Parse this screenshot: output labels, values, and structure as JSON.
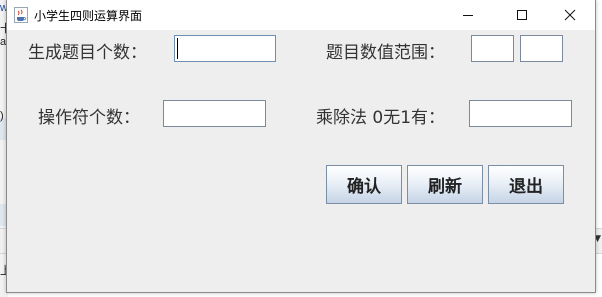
{
  "background": {
    "marks": [
      "w",
      "十",
      "a",
      ")",
      "上"
    ]
  },
  "window": {
    "title": "小学生四则运算界面",
    "icons": {
      "app": "java-coffee-icon",
      "minimize": "minimize-icon",
      "maximize": "maximize-icon",
      "close": "close-icon"
    }
  },
  "form": {
    "question_count_label": "生成题目个数：",
    "question_count_value": "",
    "range_label": "题目数值范围：",
    "range_min_value": "",
    "range_max_value": "",
    "operator_count_label": "操作符个数：",
    "operator_count_value": "",
    "muldiv_label": "乘除法 0无1有：",
    "muldiv_value": ""
  },
  "buttons": {
    "confirm": "确认",
    "refresh": "刷新",
    "exit": "退出"
  },
  "colors": {
    "window_bg": "#eeeeee",
    "titlebar_bg": "#ffffff",
    "button_gradient_top": "#ffffff",
    "button_gradient_bottom": "#c5d4e6",
    "field_border": "#7a8a9c",
    "label_text": "#333333"
  }
}
